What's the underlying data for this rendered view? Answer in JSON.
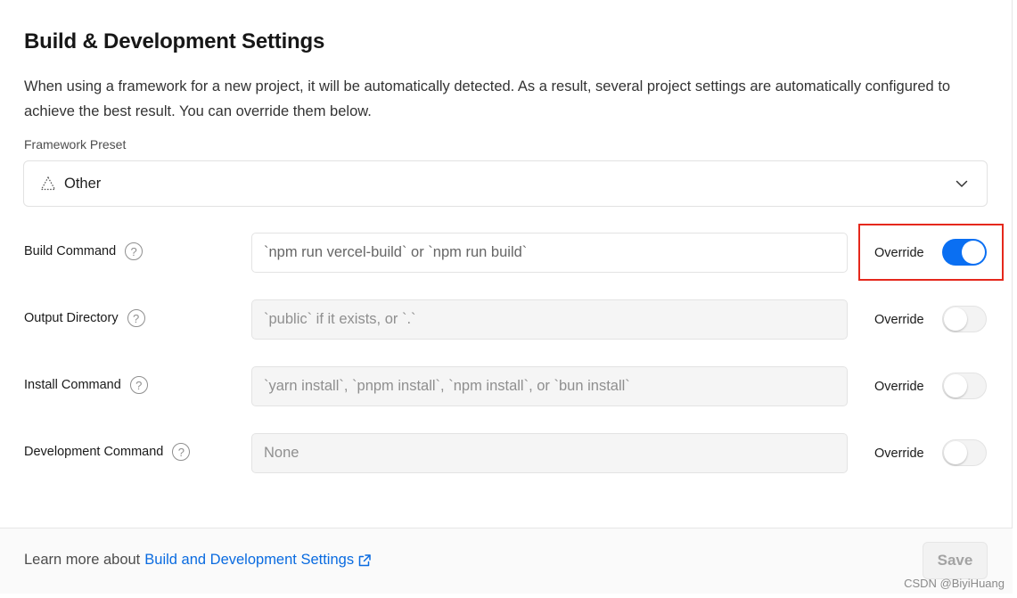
{
  "section": {
    "title": "Build & Development Settings",
    "description": "When using a framework for a new project, it will be automatically detected. As a result, several project settings are automatically configured to achieve the best result. You can override them below."
  },
  "framework": {
    "label": "Framework Preset",
    "selected": "Other"
  },
  "rows": [
    {
      "label": "Build Command",
      "placeholder": "`npm run vercel-build` or `npm run build`",
      "override_label": "Override",
      "override_on": true
    },
    {
      "label": "Output Directory",
      "placeholder": "`public` if it exists, or `.`",
      "override_label": "Override",
      "override_on": false
    },
    {
      "label": "Install Command",
      "placeholder": "`yarn install`, `pnpm install`, `npm install`, or `bun install`",
      "override_label": "Override",
      "override_on": false
    },
    {
      "label": "Development Command",
      "placeholder": "None",
      "override_label": "Override",
      "override_on": false
    }
  ],
  "help_glyph": "?",
  "footer": {
    "learn_prefix": "Learn more about",
    "learn_link": "Build and Development Settings",
    "save_label": "Save"
  },
  "watermark": "CSDN @BiyiHuang",
  "colors": {
    "accent": "#0a6ff2",
    "link": "#0a6be0",
    "highlight": "#e5281c"
  }
}
